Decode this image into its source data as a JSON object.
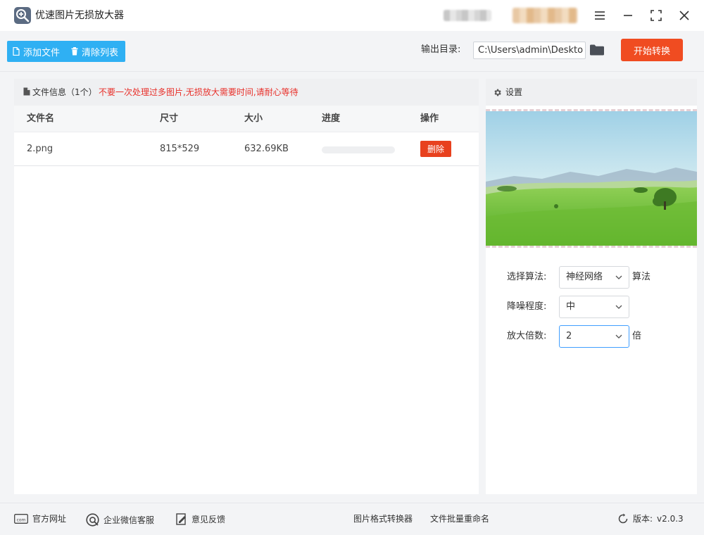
{
  "window": {
    "title": "优速图片无损放大器",
    "controls": [
      "menu-icon",
      "minimize-icon",
      "maximize-icon",
      "close-icon"
    ]
  },
  "toolbar": {
    "add_file_label": "添加文件",
    "clear_list_label": "清除列表",
    "output_dir_label": "输出目录:",
    "output_dir_value": "C:\\Users\\admin\\Deskto",
    "start_label": "开始转换"
  },
  "file_panel": {
    "title": "文件信息（1个）",
    "warning": "不要一次处理过多图片,无损放大需要时间,请耐心等待",
    "columns": {
      "name": "文件名",
      "size": "尺寸",
      "filesize": "大小",
      "progress": "进度",
      "action": "操作"
    },
    "rows": [
      {
        "name": "2.png",
        "dimensions": "815*529",
        "filesize": "632.69KB",
        "progress": 0,
        "action_label": "删除"
      }
    ]
  },
  "settings": {
    "title": "设置",
    "algorithm_label": "选择算法:",
    "algorithm_value": "神经网络",
    "algorithm_suffix": "算法",
    "denoise_label": "降噪程度:",
    "denoise_value": "中",
    "scale_label": "放大倍数:",
    "scale_value": "2",
    "scale_suffix": "倍"
  },
  "footer": {
    "website_label": "官方网址",
    "wechat_label": "企业微信客服",
    "feedback_label": "意见反馈",
    "format_converter_label": "图片格式转换器",
    "batch_rename_label": "文件批量重命名",
    "version_label": "版本:",
    "version_value": "v2.0.3"
  },
  "colors": {
    "accent_blue": "#2fb0f3",
    "start_orange": "#f04c21",
    "delete_red": "#e8411e",
    "warning_red": "#e8302a"
  }
}
